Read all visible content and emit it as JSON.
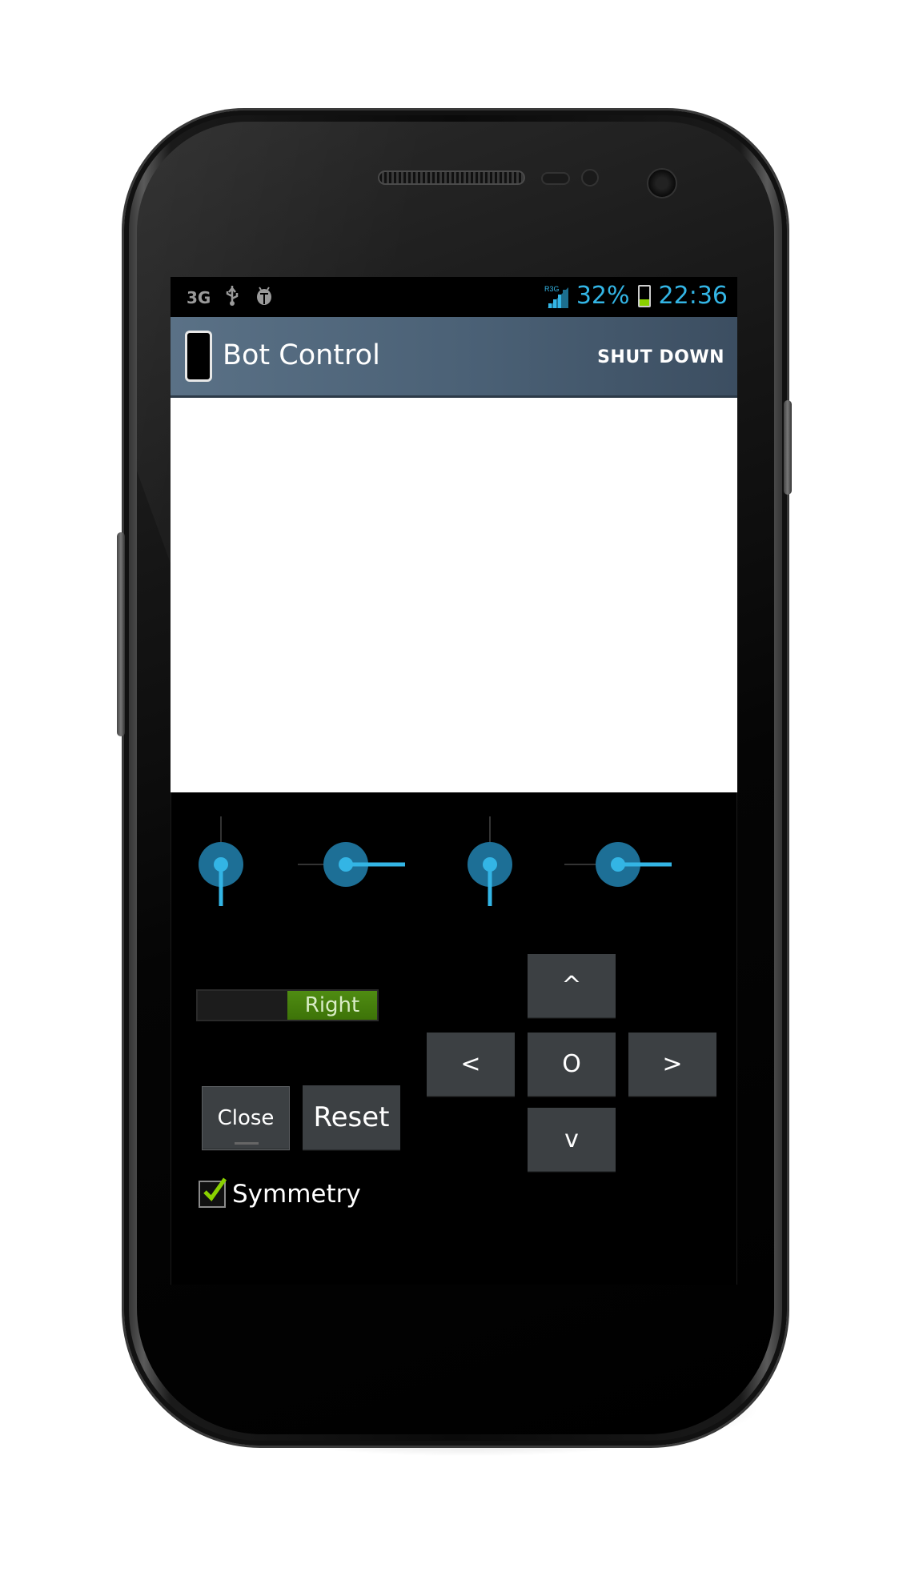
{
  "status_bar": {
    "network_type": "3G",
    "usb_icon": "usb-icon",
    "debug_icon": "android-debug-icon",
    "signal_label": "R3G",
    "battery_percent": "32%",
    "battery_level": 0.32,
    "time": "22:36"
  },
  "action_bar": {
    "title": "Bot Control",
    "app_icon": "phone-icon",
    "action_label": "SHUT DOWN"
  },
  "canvas": {
    "background": "#ffffff"
  },
  "dials": [
    {
      "name": "dial-1",
      "pointer_direction": "down"
    },
    {
      "name": "dial-2",
      "pointer_direction": "right"
    },
    {
      "name": "dial-3",
      "pointer_direction": "down"
    },
    {
      "name": "dial-4",
      "pointer_direction": "right"
    }
  ],
  "toggle": {
    "on_label": "Right",
    "state": "on"
  },
  "buttons": {
    "close": "Close",
    "reset": "Reset"
  },
  "dpad": {
    "up": "^",
    "left": "<",
    "center": "O",
    "right": ">",
    "down": "v"
  },
  "symmetry": {
    "label": "Symmetry",
    "checked": true
  },
  "colors": {
    "accent": "#33b5e5",
    "action_bar": "#4a6075",
    "toggle_on": "#4f8c12",
    "button": "#3c4043",
    "check": "#8ad100"
  }
}
